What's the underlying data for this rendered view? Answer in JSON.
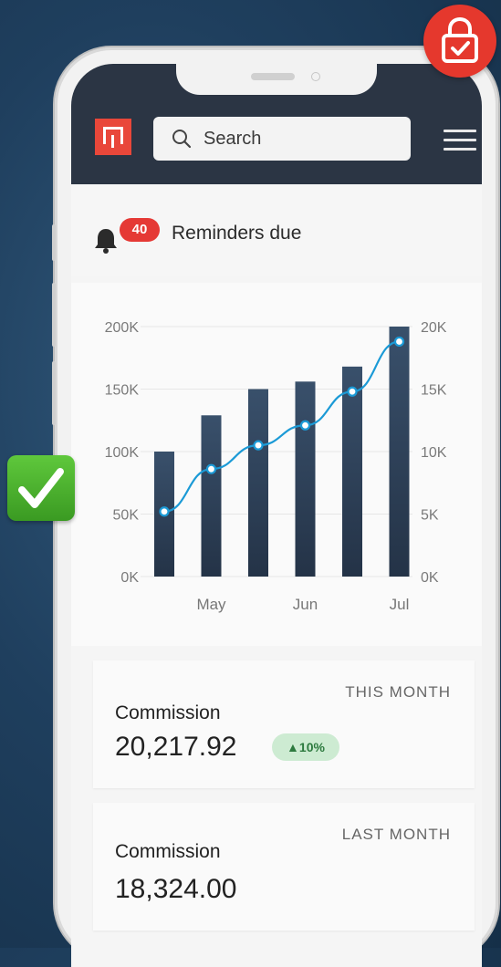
{
  "header": {
    "logo_icon": "brand-logo-icon",
    "search_placeholder": "Search",
    "menu_icon": "hamburger-menu-icon"
  },
  "reminders": {
    "count": "40",
    "label": "Reminders due",
    "icon": "bell-icon"
  },
  "chart_data": {
    "type": "bar",
    "categories": [
      "",
      "May",
      "",
      "Jun",
      "",
      "Jul"
    ],
    "x_tick_labels": [
      "May",
      "Jun",
      "Jul"
    ],
    "left_axis_ticks": [
      "0K",
      "50K",
      "100K",
      "150K",
      "200K"
    ],
    "right_axis_ticks": [
      "0K",
      "5K",
      "10K",
      "15K",
      "20K"
    ],
    "ylim_left": [
      0,
      200000
    ],
    "ylim_right": [
      0,
      20000
    ],
    "grid": true,
    "series": [
      {
        "type": "bar",
        "axis": "left",
        "values": [
          100000,
          129000,
          150000,
          156000,
          168000,
          200000
        ]
      },
      {
        "type": "line",
        "axis": "right",
        "values": [
          5200,
          8600,
          10500,
          12100,
          14800,
          18800
        ]
      }
    ],
    "colors": {
      "bar": "#2e4058",
      "line": "#1b9ad6"
    }
  },
  "commission_this_month": {
    "period": "THIS MONTH",
    "label": "Commission",
    "value": "20,217.92",
    "trend": "▲10%"
  },
  "commission_last_month": {
    "period": "LAST MONTH",
    "label": "Commission",
    "value": "18,324.00"
  },
  "overlays": {
    "lock_icon": "lock-check-icon",
    "check_icon": "checkmark-icon"
  },
  "colors": {
    "accent": "#e9473a",
    "header_bg": "#2b3544",
    "trend_bg": "#cdebd2"
  }
}
